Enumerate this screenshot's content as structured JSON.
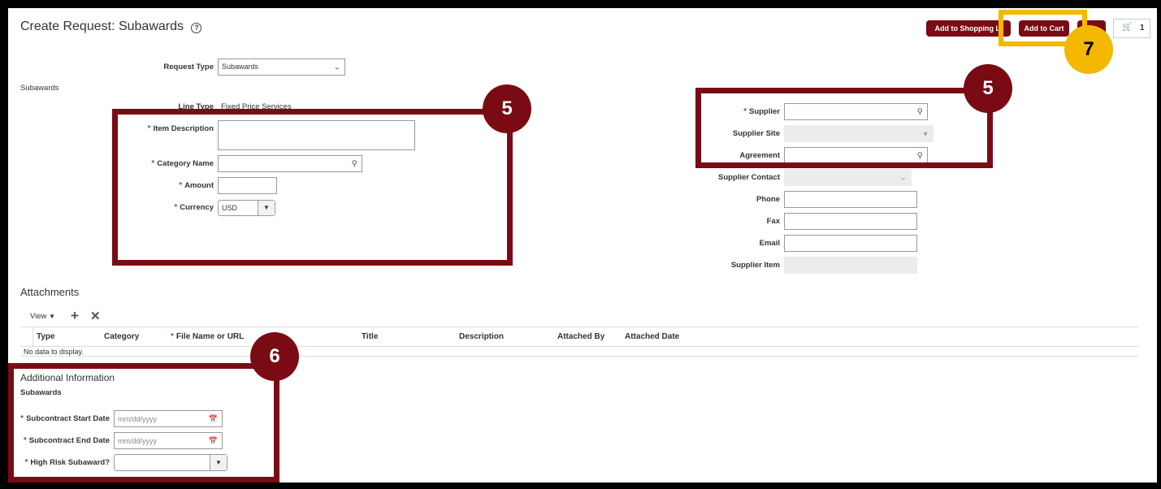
{
  "header": {
    "title": "Create Request: Subawards",
    "help_icon": "?",
    "buttons": {
      "add_to_shopping_list": "Add to Shopping Li",
      "add_to_cart": "Add to Cart"
    },
    "cart_count": "1"
  },
  "form": {
    "request_type_label": "Request Type",
    "request_type_value": "Subawards",
    "section_label": "Subawards",
    "line_type_label": "Line Type",
    "line_type_value": "Fixed Price Services",
    "item_description_label": "Item Description",
    "category_name_label": "Category Name",
    "amount_label": "Amount",
    "currency_label": "Currency",
    "currency_value": "USD",
    "supplier_label": "Supplier",
    "supplier_site_label": "Supplier Site",
    "agreement_label": "Agreement",
    "supplier_contact_label": "Supplier Contact",
    "phone_label": "Phone",
    "fax_label": "Fax",
    "email_label": "Email",
    "supplier_item_label": "Supplier Item"
  },
  "attachments": {
    "title": "Attachments",
    "view_label": "View",
    "columns": [
      "Type",
      "Category",
      "File Name or URL",
      "Title",
      "Description",
      "Attached By",
      "Attached Date"
    ],
    "empty": "No data to display."
  },
  "additional": {
    "title": "Additional Information",
    "subtitle": "Subawards",
    "start_label": "Subcontract Start Date",
    "end_label": "Subcontract End Date",
    "risk_label": "High Risk Subaward?",
    "date_placeholder": "mm/dd/yyyy"
  },
  "annotations": {
    "n5": "5",
    "n6": "6",
    "n7": "7"
  },
  "colors": {
    "brand": "#7a0b14",
    "highlight": "#f5b800",
    "required": "#2d6ec9"
  }
}
